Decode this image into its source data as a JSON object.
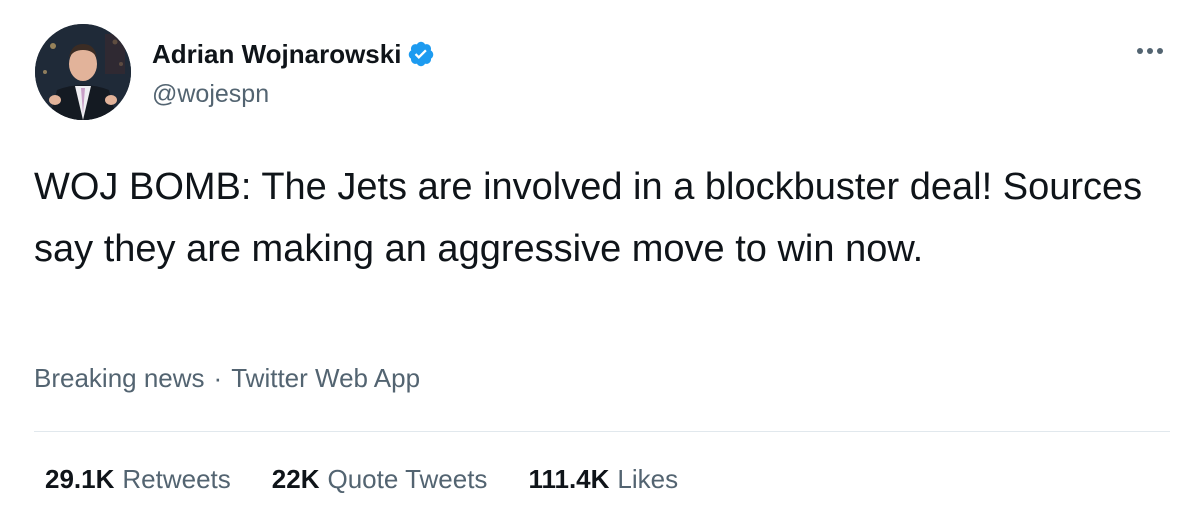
{
  "author": {
    "display_name": "Adrian Wojnarowski",
    "handle": "@wojespn",
    "verified": true,
    "verified_color": "#1d9bf0"
  },
  "tweet": {
    "text": "WOJ BOMB: The Jets are involved in a blockbuster deal! Sources say they are making an aggressive move to win now."
  },
  "meta": {
    "timestamp": "Breaking news",
    "separator": "·",
    "source": "Twitter Web App"
  },
  "stats": [
    {
      "count": "29.1K",
      "label": "Retweets"
    },
    {
      "count": "22K",
      "label": "Quote Tweets"
    },
    {
      "count": "111.4K",
      "label": "Likes"
    }
  ],
  "icons": {
    "more": "more-horizontal-icon",
    "verified": "verified-badge-icon"
  },
  "colors": {
    "text_primary": "#0f1419",
    "text_secondary": "#536471",
    "divider": "#e1e8ed"
  }
}
